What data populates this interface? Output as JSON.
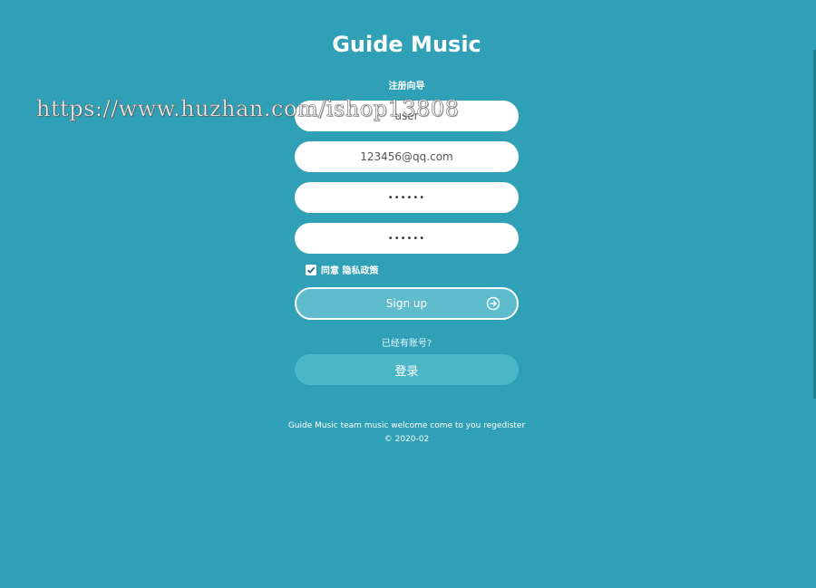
{
  "app": {
    "title": "Guide Music",
    "subtitle": "注册向导"
  },
  "watermark": "https://www.huzhan.com/ishop13808",
  "form": {
    "username_value": "user",
    "email_value": "123456@qq.com",
    "password_value": "••••••",
    "confirm_password_value": "••••••",
    "agree_label": "同意 隐私政策",
    "agree_checked": true,
    "signup_label": "Sign up",
    "have_account_text": "已经有账号?",
    "login_label": "登录"
  },
  "footer": {
    "line1": "Guide Music team music welcome come to you regedister",
    "line2": "© 2020-02"
  },
  "colors": {
    "background": "#2fa0b6",
    "signup_fill": "#5fbccc",
    "login_fill": "#4cb6c9"
  }
}
